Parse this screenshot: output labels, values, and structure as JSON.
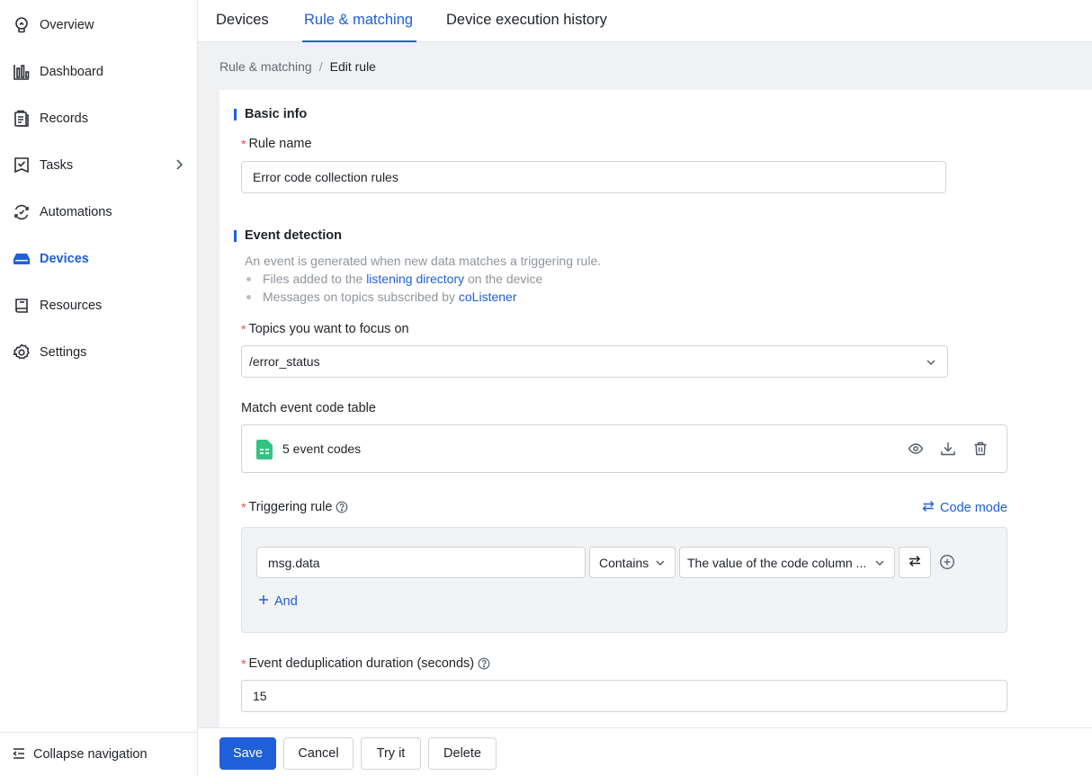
{
  "sidebar": {
    "items": [
      {
        "label": "Overview",
        "icon": "lightbulb-icon"
      },
      {
        "label": "Dashboard",
        "icon": "bar-chart-icon"
      },
      {
        "label": "Records",
        "icon": "clipboard-icon"
      },
      {
        "label": "Tasks",
        "icon": "task-checklist-icon"
      },
      {
        "label": "Automations",
        "icon": "automation-icon"
      },
      {
        "label": "Devices",
        "icon": "device-icon"
      },
      {
        "label": "Resources",
        "icon": "book-icon"
      },
      {
        "label": "Settings",
        "icon": "gear-icon"
      }
    ],
    "active": "Devices",
    "collapse_label": "Collapse navigation"
  },
  "tabs": [
    {
      "label": "Devices"
    },
    {
      "label": "Rule & matching"
    },
    {
      "label": "Device execution history"
    }
  ],
  "active_tab": "Rule & matching",
  "breadcrumb": {
    "parent": "Rule & matching",
    "separator": "/",
    "current": "Edit rule"
  },
  "basic_info": {
    "title": "Basic info",
    "rule_name_label": "Rule name",
    "rule_name_value": "Error code collection rules"
  },
  "event_detection": {
    "title": "Event detection",
    "description": "An event is generated when new data matches a triggering rule.",
    "bullet1_pre": "Files added to the",
    "bullet1_link": "listening directory",
    "bullet1_post": "on the device",
    "bullet2_pre": "Messages on topics subscribed by",
    "bullet2_link": "coListener",
    "topics_label": "Topics you want to focus on",
    "topics_value": "/error_status",
    "table_label": "Match event code table",
    "table_file_label": "5 event codes",
    "trigger_label": "Triggering rule",
    "code_mode_label": "Code mode",
    "rule": {
      "field": "msg.data",
      "operator": "Contains",
      "value": "The value of the code column ..."
    },
    "add_and_label": "And",
    "dedup_label": "Event deduplication duration (seconds)",
    "dedup_value": "15"
  },
  "footer": {
    "save": "Save",
    "cancel": "Cancel",
    "try": "Try it",
    "delete": "Delete"
  },
  "colors": {
    "accent": "#1f5fd9",
    "required": "#f54a45",
    "sheet_icon": "#34c37f"
  }
}
